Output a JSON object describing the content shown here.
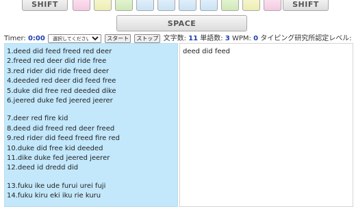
{
  "keyboard": {
    "shift_left_label": "SHIFT",
    "shift_right_label": "SHIFT",
    "space_label": "SPACE",
    "key_colors": {
      "pink": "#f5c9e1",
      "yellow": "#ecedb2",
      "green": "#cfe9b7",
      "blue": "#c9e2f4"
    }
  },
  "controls": {
    "timer_label": "Timer:",
    "timer_value": "0:00",
    "level_select_value": "選択してください",
    "start_button": "スタート",
    "stop_button": "ストップ",
    "char_count_label": "文字数:",
    "char_count_value": "11",
    "word_count_label": "単語数:",
    "word_count_value": "3",
    "wpm_label": "WPM:",
    "wpm_value": "0",
    "certification_label": "タイピング研究所認定レベル:"
  },
  "lesson": {
    "lines": [
      "1.deed did feed freed red deer",
      "2.freed red deer did ride free",
      "3.red rider did ride freed deer",
      "4.deeded red deer did feed free",
      "5.duke did free red deeded dike",
      "6.jeered duke fed jeered jeerer",
      "7.deer red fire kid",
      "8.deed did freed red deer freed",
      "9.red rider did feed freed fire red",
      "10.duke did free kid deeded",
      "11.dike duke fed jeered jeerer",
      "12.deed id dredd did",
      "13.fuku ike ude furui urei fuji",
      "14.fuku kiru eki iku rie kuru"
    ]
  },
  "input": {
    "typed_text": "deed did feed"
  },
  "colors": {
    "lesson_background": "#c3e8fb",
    "stat_value": "#1a3fb0"
  }
}
